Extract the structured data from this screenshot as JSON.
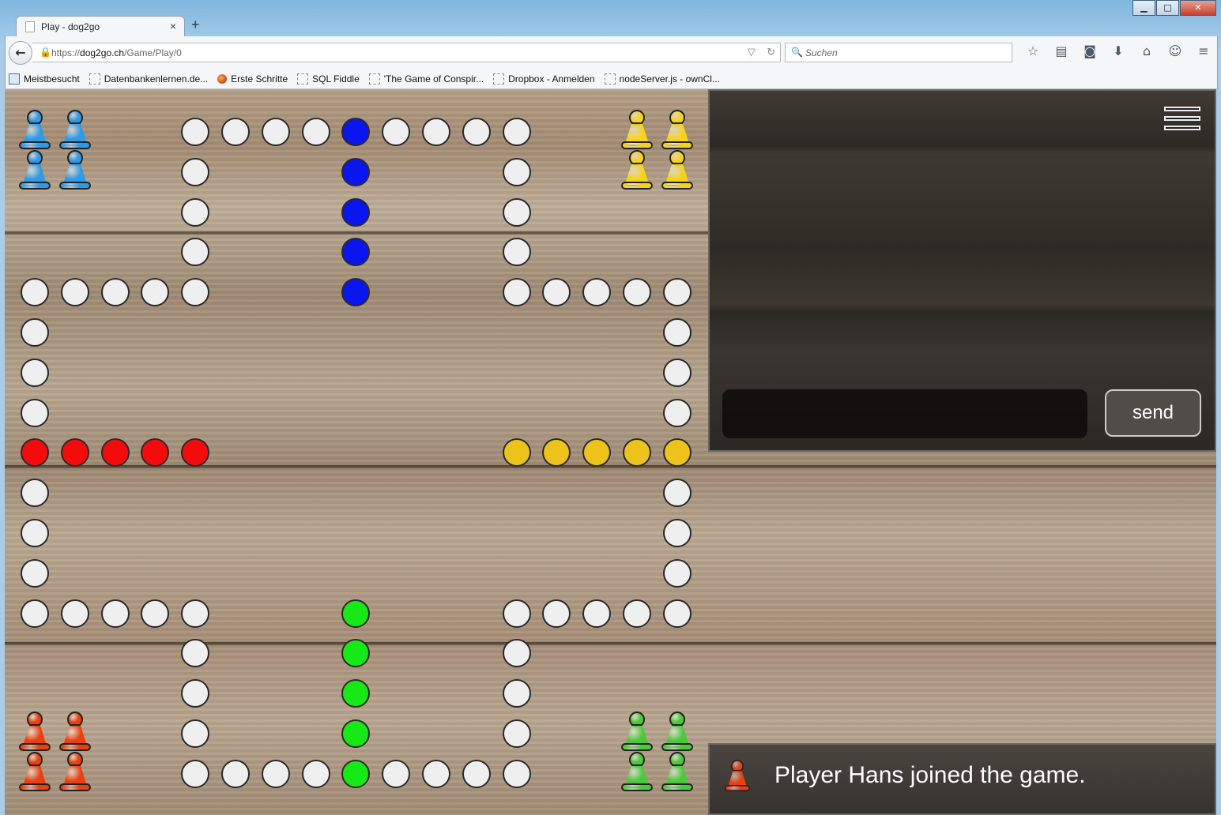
{
  "window": {
    "minimize": "▁",
    "maximize": "□",
    "close": "✕"
  },
  "tab": {
    "title": "Play - dog2go",
    "close": "×",
    "new_tab": "+"
  },
  "nav": {
    "url_prefix": "https://",
    "url_host": "dog2go.ch",
    "url_path": "/Game/Play/0",
    "search_placeholder": "Suchen",
    "icons": [
      "bookmark-star-icon",
      "reading-list-icon",
      "pocket-icon",
      "download-icon",
      "home-icon",
      "chat-icon",
      "menu-icon"
    ],
    "icon_glyphs": [
      "☆",
      "▤",
      "◙",
      "⬇",
      "⌂",
      "☺",
      "≡"
    ]
  },
  "bookmarks": [
    {
      "label": "Meistbesucht",
      "icon": "mb"
    },
    {
      "label": "Datenbankenlernen.de...",
      "icon": "page"
    },
    {
      "label": "Erste Schritte",
      "icon": "ff"
    },
    {
      "label": "SQL Fiddle",
      "icon": "page"
    },
    {
      "label": "'The Game of Conspir...",
      "icon": "page"
    },
    {
      "label": "Dropbox - Anmelden",
      "icon": "page"
    },
    {
      "label": "nodeServer.js - ownCl...",
      "icon": "page"
    }
  ],
  "colors": {
    "empty": "#efefef",
    "blue": "#0a16f0",
    "red": "#f40c0c",
    "yellow": "#edc21a",
    "green": "#16e916",
    "peg_blue": "#2f9be6",
    "peg_yellow": "#f6d21e",
    "peg_red": "#e8410f",
    "peg_green": "#4cc93a"
  },
  "board": {
    "cols": [
      0,
      0,
      0,
      0,
      0,
      0,
      0,
      0,
      0,
      0,
      0,
      0,
      0,
      0,
      0,
      0,
      0
    ],
    "holes": [
      [
        4,
        0,
        "empty"
      ],
      [
        5,
        0,
        "empty"
      ],
      [
        6,
        0,
        "empty"
      ],
      [
        7,
        0,
        "empty"
      ],
      [
        8,
        0,
        "blue"
      ],
      [
        9,
        0,
        "empty"
      ],
      [
        10,
        0,
        "empty"
      ],
      [
        11,
        0,
        "empty"
      ],
      [
        12,
        0,
        "empty"
      ],
      [
        4,
        1,
        "empty"
      ],
      [
        8,
        1,
        "blue"
      ],
      [
        12,
        1,
        "empty"
      ],
      [
        4,
        2,
        "empty"
      ],
      [
        8,
        2,
        "blue"
      ],
      [
        12,
        2,
        "empty"
      ],
      [
        4,
        3,
        "empty"
      ],
      [
        8,
        3,
        "blue"
      ],
      [
        12,
        3,
        "empty"
      ],
      [
        0,
        4,
        "empty"
      ],
      [
        1,
        4,
        "empty"
      ],
      [
        2,
        4,
        "empty"
      ],
      [
        3,
        4,
        "empty"
      ],
      [
        4,
        4,
        "empty"
      ],
      [
        8,
        4,
        "blue"
      ],
      [
        12,
        4,
        "empty"
      ],
      [
        13,
        4,
        "empty"
      ],
      [
        14,
        4,
        "empty"
      ],
      [
        15,
        4,
        "empty"
      ],
      [
        16,
        4,
        "empty"
      ],
      [
        0,
        5,
        "empty"
      ],
      [
        16,
        5,
        "empty"
      ],
      [
        0,
        6,
        "empty"
      ],
      [
        16,
        6,
        "empty"
      ],
      [
        0,
        7,
        "empty"
      ],
      [
        16,
        7,
        "empty"
      ],
      [
        0,
        8,
        "red"
      ],
      [
        1,
        8,
        "red"
      ],
      [
        2,
        8,
        "red"
      ],
      [
        3,
        8,
        "red"
      ],
      [
        4,
        8,
        "red"
      ],
      [
        12,
        8,
        "yellow"
      ],
      [
        13,
        8,
        "yellow"
      ],
      [
        14,
        8,
        "yellow"
      ],
      [
        15,
        8,
        "yellow"
      ],
      [
        16,
        8,
        "yellow"
      ],
      [
        0,
        9,
        "empty"
      ],
      [
        16,
        9,
        "empty"
      ],
      [
        0,
        10,
        "empty"
      ],
      [
        16,
        10,
        "empty"
      ],
      [
        0,
        11,
        "empty"
      ],
      [
        16,
        11,
        "empty"
      ],
      [
        0,
        12,
        "empty"
      ],
      [
        1,
        12,
        "empty"
      ],
      [
        2,
        12,
        "empty"
      ],
      [
        3,
        12,
        "empty"
      ],
      [
        4,
        12,
        "empty"
      ],
      [
        8,
        12,
        "green"
      ],
      [
        12,
        12,
        "empty"
      ],
      [
        13,
        12,
        "empty"
      ],
      [
        14,
        12,
        "empty"
      ],
      [
        15,
        12,
        "empty"
      ],
      [
        16,
        12,
        "empty"
      ],
      [
        4,
        13,
        "empty"
      ],
      [
        8,
        13,
        "green"
      ],
      [
        12,
        13,
        "empty"
      ],
      [
        4,
        14,
        "empty"
      ],
      [
        8,
        14,
        "green"
      ],
      [
        12,
        14,
        "empty"
      ],
      [
        4,
        15,
        "empty"
      ],
      [
        8,
        15,
        "green"
      ],
      [
        12,
        15,
        "empty"
      ],
      [
        4,
        16,
        "empty"
      ],
      [
        5,
        16,
        "empty"
      ],
      [
        6,
        16,
        "empty"
      ],
      [
        7,
        16,
        "empty"
      ],
      [
        8,
        16,
        "green"
      ],
      [
        9,
        16,
        "empty"
      ],
      [
        10,
        16,
        "empty"
      ],
      [
        11,
        16,
        "empty"
      ],
      [
        12,
        16,
        "empty"
      ]
    ],
    "pegs": [
      [
        0,
        0,
        "peg_blue"
      ],
      [
        1,
        0,
        "peg_blue"
      ],
      [
        0,
        1,
        "peg_blue"
      ],
      [
        1,
        1,
        "peg_blue"
      ],
      [
        15,
        0,
        "peg_yellow"
      ],
      [
        16,
        0,
        "peg_yellow"
      ],
      [
        15,
        1,
        "peg_yellow"
      ],
      [
        16,
        1,
        "peg_yellow"
      ],
      [
        0,
        15,
        "peg_red"
      ],
      [
        1,
        15,
        "peg_red"
      ],
      [
        0,
        16,
        "peg_red"
      ],
      [
        1,
        16,
        "peg_red"
      ],
      [
        15,
        15,
        "peg_green"
      ],
      [
        16,
        15,
        "peg_green"
      ],
      [
        15,
        16,
        "peg_green"
      ],
      [
        16,
        16,
        "peg_green"
      ]
    ]
  },
  "chat": {
    "input_value": "",
    "send_label": "send"
  },
  "status": {
    "message": "Player Hans joined the game.",
    "player_color": "peg_red"
  }
}
